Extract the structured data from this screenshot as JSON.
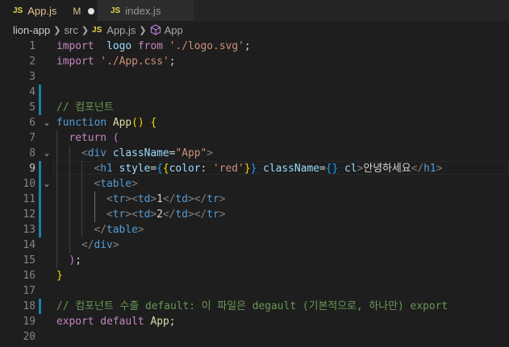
{
  "tabs": [
    {
      "icon": "JS",
      "name": "App.js",
      "status": "M"
    },
    {
      "icon": "JS",
      "name": "index.js"
    }
  ],
  "breadcrumb": {
    "project": "lion-app",
    "folder": "src",
    "file_icon": "JS",
    "file": "App.js",
    "symbol": "App"
  },
  "lines": [
    {
      "n": "1",
      "t": [
        [
          "kw",
          "import"
        ],
        [
          "",
          "  "
        ],
        [
          "vr",
          "logo"
        ],
        [
          "",
          " "
        ],
        [
          "kw",
          "from"
        ],
        [
          "",
          " "
        ],
        [
          "str",
          "'./logo.svg'"
        ],
        [
          "",
          ";"
        ]
      ]
    },
    {
      "n": "2",
      "t": [
        [
          "kw",
          "import"
        ],
        [
          "",
          " "
        ],
        [
          "str",
          "'./App.css'"
        ],
        [
          "",
          ";"
        ]
      ]
    },
    {
      "n": "3",
      "t": []
    },
    {
      "n": "4",
      "t": []
    },
    {
      "n": "5",
      "t": [
        [
          "cm",
          "// 컴포넌트"
        ]
      ]
    },
    {
      "n": "6",
      "t": [
        [
          "kwb",
          "function"
        ],
        [
          "",
          " "
        ],
        [
          "fn",
          "App"
        ],
        [
          "br1",
          "()"
        ],
        [
          "",
          " "
        ],
        [
          "br1",
          "{"
        ]
      ]
    },
    {
      "n": "7",
      "t": [
        [
          "",
          ""
        ],
        [
          "kw",
          "return"
        ],
        [
          "",
          " "
        ],
        [
          "br2",
          "("
        ]
      ]
    },
    {
      "n": "8",
      "t": [
        [
          "tgb",
          "<"
        ],
        [
          "tg",
          "div"
        ],
        [
          "",
          " "
        ],
        [
          "at",
          "className"
        ],
        [
          "",
          "="
        ],
        [
          "str",
          "\"App\""
        ],
        [
          "tgb",
          ">"
        ]
      ]
    },
    {
      "n": "9",
      "t": [
        [
          "tgb",
          "<"
        ],
        [
          "tg",
          "h1"
        ],
        [
          "",
          " "
        ],
        [
          "at",
          "style"
        ],
        [
          "",
          "="
        ],
        [
          "br3",
          "{"
        ],
        [
          "br1",
          "{"
        ],
        [
          "at",
          "color"
        ],
        [
          "",
          ": "
        ],
        [
          "str",
          "'red'"
        ],
        [
          "br1",
          "}"
        ],
        [
          "br3",
          "}"
        ],
        [
          "",
          " "
        ],
        [
          "at",
          "className"
        ],
        [
          "",
          "="
        ],
        [
          "br3",
          "{}"
        ],
        [
          "",
          " "
        ],
        [
          "at",
          "cl"
        ],
        [
          "tgb",
          ">"
        ],
        [
          "",
          "안녕하세요"
        ],
        [
          "tgb",
          "</"
        ],
        [
          "tg",
          "h1"
        ],
        [
          "tgb",
          ">"
        ]
      ]
    },
    {
      "n": "10",
      "t": [
        [
          "tgb",
          "<"
        ],
        [
          "tg",
          "table"
        ],
        [
          "tgb",
          ">"
        ]
      ]
    },
    {
      "n": "11",
      "t": [
        [
          "tgb",
          "<"
        ],
        [
          "tg",
          "tr"
        ],
        [
          "tgb",
          "><"
        ],
        [
          "tg",
          "td"
        ],
        [
          "tgb",
          ">"
        ],
        [
          "",
          "1"
        ],
        [
          "tgb",
          "</"
        ],
        [
          "tg",
          "td"
        ],
        [
          "tgb",
          "></"
        ],
        [
          "tg",
          "tr"
        ],
        [
          "tgb",
          ">"
        ]
      ]
    },
    {
      "n": "12",
      "t": [
        [
          "tgb",
          "<"
        ],
        [
          "tg",
          "tr"
        ],
        [
          "tgb",
          "><"
        ],
        [
          "tg",
          "td"
        ],
        [
          "tgb",
          ">"
        ],
        [
          "",
          "2"
        ],
        [
          "tgb",
          "</"
        ],
        [
          "tg",
          "td"
        ],
        [
          "tgb",
          "></"
        ],
        [
          "tg",
          "tr"
        ],
        [
          "tgb",
          ">"
        ]
      ]
    },
    {
      "n": "13",
      "t": [
        [
          "tgb",
          "</"
        ],
        [
          "tg",
          "table"
        ],
        [
          "tgb",
          ">"
        ]
      ]
    },
    {
      "n": "14",
      "t": [
        [
          "tgb",
          "</"
        ],
        [
          "tg",
          "div"
        ],
        [
          "tgb",
          ">"
        ]
      ]
    },
    {
      "n": "15",
      "t": [
        [
          "br2",
          ")"
        ],
        [
          "",
          ";"
        ]
      ]
    },
    {
      "n": "16",
      "t": [
        [
          "br1",
          "}"
        ]
      ]
    },
    {
      "n": "17",
      "t": []
    },
    {
      "n": "18",
      "t": [
        [
          "cm",
          "// 컴포넌트 수출 default: 이 파일은 degault (기본적으로, 하나만) export"
        ]
      ]
    },
    {
      "n": "19",
      "t": [
        [
          "kw",
          "export"
        ],
        [
          "",
          " "
        ],
        [
          "kw",
          "default"
        ],
        [
          "",
          " "
        ],
        [
          "fn",
          "App"
        ],
        [
          "",
          ";"
        ]
      ]
    },
    {
      "n": "20",
      "t": []
    }
  ],
  "colors": {
    "background": "#1e1e1e",
    "modified_gutter": "#1b81a8",
    "keyword": "#c586c0",
    "string": "#ce9178",
    "comment": "#6a9955"
  }
}
